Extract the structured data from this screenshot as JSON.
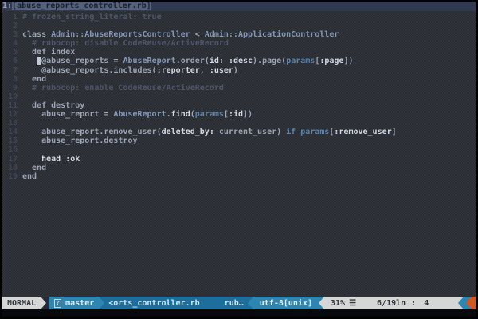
{
  "tabline": {
    "tab_number": "1:",
    "tab_label": "[abuse_reports_controller.rb]"
  },
  "editor": {
    "cursor": {
      "line": 6,
      "column": 4
    },
    "lines": [
      {
        "n": "1",
        "segs": [
          [
            "# frozen_string_literal: true",
            "cm"
          ]
        ]
      },
      {
        "n": "2",
        "segs": []
      },
      {
        "n": "3",
        "segs": [
          [
            "class ",
            "df"
          ],
          [
            "Admin::AbuseReportsController",
            "ct"
          ],
          [
            " < ",
            "df"
          ],
          [
            "Admin::ApplicationController",
            "ct"
          ]
        ]
      },
      {
        "n": "4",
        "segs": [
          [
            "  ",
            "df"
          ],
          [
            "# rubocop: disable CodeReuse/ActiveRecord",
            "cm"
          ]
        ]
      },
      {
        "n": "5",
        "segs": [
          [
            "  def index",
            "df"
          ]
        ]
      },
      {
        "n": "6",
        "segs": [
          [
            "   ",
            "df"
          ],
          [
            " ",
            "cur"
          ],
          [
            "@abuse_reports = ",
            "df"
          ],
          [
            "AbuseReport",
            "ct"
          ],
          [
            ".order(",
            "df"
          ],
          [
            "id:",
            "sy"
          ],
          [
            " ",
            "df"
          ],
          [
            ":desc",
            "sy"
          ],
          [
            ").page(",
            "df"
          ],
          [
            "params",
            "kw"
          ],
          [
            "[",
            "df"
          ],
          [
            ":page",
            "sy"
          ],
          [
            "])",
            "df"
          ]
        ]
      },
      {
        "n": "7",
        "segs": [
          [
            "    @abuse_reports.includes(",
            "df"
          ],
          [
            ":reporter",
            "sy"
          ],
          [
            ", ",
            "df"
          ],
          [
            ":user",
            "sy"
          ],
          [
            ")",
            "df"
          ]
        ]
      },
      {
        "n": "8",
        "segs": [
          [
            "  end",
            "df"
          ]
        ]
      },
      {
        "n": "9",
        "segs": [
          [
            "  ",
            "df"
          ],
          [
            "# rubocop: enable CodeReuse/ActiveRecord",
            "cm"
          ]
        ]
      },
      {
        "n": "10",
        "segs": []
      },
      {
        "n": "11",
        "segs": [
          [
            "  def destroy",
            "df"
          ]
        ]
      },
      {
        "n": "12",
        "segs": [
          [
            "    abuse_report = ",
            "df"
          ],
          [
            "AbuseReport",
            "ct"
          ],
          [
            ".",
            "df"
          ],
          [
            "find",
            "sy"
          ],
          [
            "(",
            "df"
          ],
          [
            "params",
            "kw"
          ],
          [
            "[",
            "df"
          ],
          [
            ":id",
            "sy"
          ],
          [
            "])",
            "df"
          ]
        ]
      },
      {
        "n": "13",
        "segs": []
      },
      {
        "n": "14",
        "segs": [
          [
            "    abuse_report.remove_user(",
            "df"
          ],
          [
            "deleted_by:",
            "sy"
          ],
          [
            " current_user) ",
            "df"
          ],
          [
            "if",
            "kw"
          ],
          [
            " ",
            "df"
          ],
          [
            "params",
            "kw"
          ],
          [
            "[",
            "df"
          ],
          [
            ":remove_user",
            "sy"
          ],
          [
            "]",
            "df"
          ]
        ]
      },
      {
        "n": "15",
        "segs": [
          [
            "    abuse_report.destroy",
            "df"
          ]
        ]
      },
      {
        "n": "16",
        "segs": []
      },
      {
        "n": "17",
        "segs": [
          [
            "    ",
            "df"
          ],
          [
            "head",
            "sy"
          ],
          [
            " ",
            "df"
          ],
          [
            ":ok",
            "sy"
          ]
        ]
      },
      {
        "n": "18",
        "segs": [
          [
            "  end",
            "df"
          ]
        ]
      },
      {
        "n": "19",
        "segs": [
          [
            "end",
            "df"
          ]
        ]
      }
    ]
  },
  "statusline": {
    "mode": "NORMAL",
    "branch_icon_fallback": "?",
    "branch": "master",
    "filename": "<orts_controller.rb",
    "filetype": "rub…",
    "encoding": "utf-8[unix]",
    "scroll_percent": "31%",
    "line_indicator_icon": "☰",
    "position": "6/19",
    "maxline_symbol": "ln",
    "col_separator": ":",
    "column": "4"
  },
  "colors": {
    "bg": "#272c37",
    "bg_tabline": "#313a50",
    "tab_bg": "#53627a",
    "tab_fg": "#1a202c",
    "tabnum_fg": "#93a0b6",
    "fg_default": "#9ba4b3",
    "fg_comment": "#4d5669",
    "fg_constant": "#8398b8",
    "fg_symbol": "#d2d8e2",
    "fg_keyword": "#5d83a8",
    "fg_linenr": "#3e4757",
    "cursor": "#c3c9d4",
    "bar_dark": "#262b36",
    "bar_light": "#d5d7d6",
    "bar_light_fg": "#32373e",
    "bar_teal": "#2d86b2",
    "bar_teal_fg": "#dcecf5",
    "bar_blue": "#1d6e9c",
    "bar_blue_fg": "#cde4f0",
    "bar_orange": "#d2571d",
    "cmdline_bg": "#07090c"
  }
}
